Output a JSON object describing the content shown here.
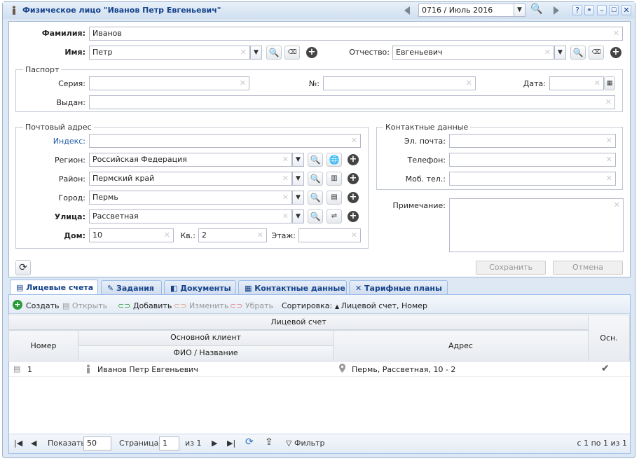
{
  "window": {
    "title": "Физическое лицо \"Иванов Петр Евгеньевич\"",
    "period": "0716 / Июль 2016"
  },
  "person": {
    "surname_label": "Фамилия:",
    "surname": "Иванов",
    "name_label": "Имя:",
    "name": "Петр",
    "patronymic_label": "Отчество:",
    "patronymic": "Евгеньевич"
  },
  "passport": {
    "legend": "Паспорт",
    "series_label": "Серия:",
    "series": "",
    "number_label": "№:",
    "number": "",
    "date_label": "Дата:",
    "date": "",
    "issued_label": "Выдан:",
    "issued": ""
  },
  "address": {
    "legend": "Почтовый адрес",
    "index_label": "Индекс:",
    "index": "",
    "region_label": "Регион:",
    "region": "Российская Федерация",
    "district_label": "Район:",
    "district": "Пермский край",
    "city_label": "Город:",
    "city": "Пермь",
    "street_label": "Улица:",
    "street": "Рассветная",
    "house_label": "Дом:",
    "house": "10",
    "flat_label": "Кв.:",
    "flat": "2",
    "floor_label": "Этаж:",
    "floor": ""
  },
  "contacts": {
    "legend": "Контактные данные",
    "email_label": "Эл. почта:",
    "email": "",
    "phone_label": "Телефон:",
    "phone": "",
    "mobile_label": "Моб. тел.:",
    "mobile": ""
  },
  "note_label": "Примечание:",
  "note": "",
  "save_label": "Сохранить",
  "cancel_label": "Отмена",
  "tabs": [
    {
      "label": "Лицевые счета",
      "icon": "account-icon"
    },
    {
      "label": "Задания",
      "icon": "task-icon"
    },
    {
      "label": "Документы",
      "icon": "document-icon"
    },
    {
      "label": "Контактные данные",
      "icon": "contact-card-icon"
    },
    {
      "label": "Тарифные планы",
      "icon": "tariff-icon"
    }
  ],
  "toolbar": {
    "create": "Создать",
    "open": "Открыть",
    "add": "Добавить",
    "edit": "Изменить",
    "remove": "Убрать",
    "sort_label": "Сортировка:",
    "sort_value": "Лицевой счет, Номер"
  },
  "grid": {
    "group_header": "Лицевой счет",
    "col_number": "Номер",
    "col_client_group": "Основной клиент",
    "col_client": "ФИО / Название",
    "col_address": "Адрес",
    "col_main": "Осн.",
    "rows": [
      {
        "number": "1",
        "client": "Иванов Петр Евгеньевич",
        "address": "Пермь, Рассветная, 10 - 2",
        "main": "✔"
      }
    ]
  },
  "pager": {
    "show_label": "Показать",
    "page_size": "50",
    "page_label": "Страница",
    "page": "1",
    "of_label": "из 1",
    "filter_label": "Фильтр",
    "summary": "с 1 по 1 из 1"
  }
}
